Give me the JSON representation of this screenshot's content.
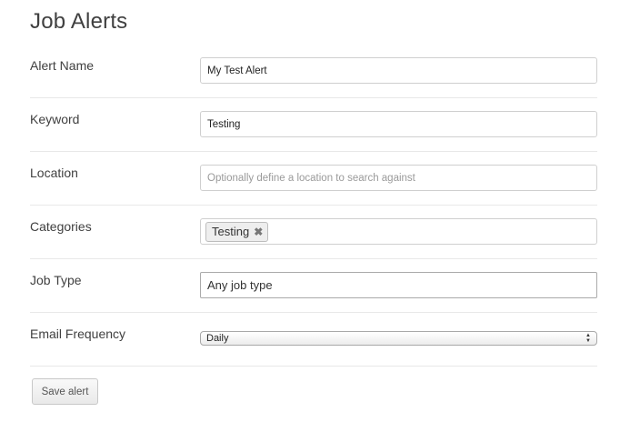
{
  "page": {
    "title": "Job Alerts"
  },
  "form": {
    "alert_name": {
      "label": "Alert Name",
      "value": "My Test Alert"
    },
    "keyword": {
      "label": "Keyword",
      "value": "Testing"
    },
    "location": {
      "label": "Location",
      "value": "",
      "placeholder": "Optionally define a location to search against"
    },
    "categories": {
      "label": "Categories",
      "selected": [
        "Testing"
      ],
      "remove_glyph": "✖"
    },
    "job_type": {
      "label": "Job Type",
      "value": "Any job type"
    },
    "email_frequency": {
      "label": "Email Frequency",
      "value": "Daily",
      "arrow_up": "▲",
      "arrow_down": "▼"
    },
    "save_label": "Save alert"
  }
}
